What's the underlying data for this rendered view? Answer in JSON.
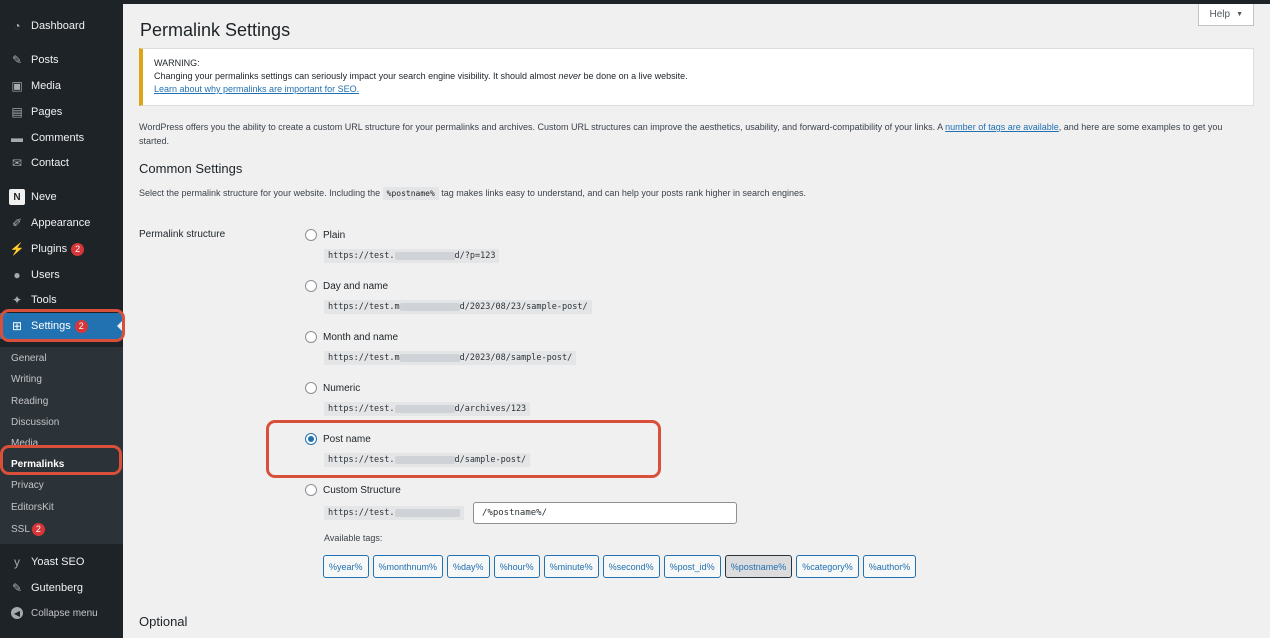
{
  "sidebar": {
    "menu": [
      {
        "id": "dashboard",
        "label": "Dashboard",
        "icon": "dashboard-icon",
        "glyph": "◔"
      },
      {
        "id": "posts",
        "label": "Posts",
        "icon": "pin-icon",
        "glyph": "✎"
      },
      {
        "id": "media",
        "label": "Media",
        "icon": "media-icon",
        "glyph": "▣"
      },
      {
        "id": "pages",
        "label": "Pages",
        "icon": "pages-icon",
        "glyph": "▤"
      },
      {
        "id": "comments",
        "label": "Comments",
        "icon": "comment-icon",
        "glyph": "▬"
      },
      {
        "id": "contact",
        "label": "Contact",
        "icon": "envelope-icon",
        "glyph": "✉"
      },
      {
        "id": "neve",
        "label": "Neve",
        "icon": "neve-logo-icon",
        "glyph": "N"
      },
      {
        "id": "appearance",
        "label": "Appearance",
        "icon": "brush-icon",
        "glyph": "✐"
      },
      {
        "id": "plugins",
        "label": "Plugins",
        "icon": "plug-icon",
        "glyph": "⚡",
        "badge": "2"
      },
      {
        "id": "users",
        "label": "Users",
        "icon": "user-icon",
        "glyph": "●"
      },
      {
        "id": "tools",
        "label": "Tools",
        "icon": "wrench-icon",
        "glyph": "✦"
      },
      {
        "id": "settings",
        "label": "Settings",
        "icon": "settings-icon",
        "glyph": "⊞",
        "badge": "2"
      }
    ],
    "submenu": [
      "General",
      "Writing",
      "Reading",
      "Discussion",
      "Media",
      "Permalinks",
      "Privacy",
      "EditorsKit",
      "SSL"
    ],
    "ssl_badge": "2",
    "bottom": [
      {
        "id": "yoast",
        "label": "Yoast SEO",
        "icon": "yoast-icon",
        "glyph": "y"
      },
      {
        "id": "gutenberg",
        "label": "Gutenberg",
        "icon": "pencil-icon",
        "glyph": "✎"
      },
      {
        "id": "collapse",
        "label": "Collapse menu",
        "icon": "collapse-icon",
        "glyph": "◀"
      }
    ]
  },
  "header": {
    "help_label": "Help",
    "help_arrow": "▼"
  },
  "page_title": "Permalink Settings",
  "warning": {
    "title": "WARNING:",
    "text_before": "Changing your permalinks settings can seriously impact your search engine visibility. It should almost ",
    "text_em": "never",
    "text_after": " be done on a live website.",
    "link": "Learn about why permalinks are important for SEO."
  },
  "intro": {
    "before": "WordPress offers you the ability to create a custom URL structure for your permalinks and archives. Custom URL structures can improve the aesthetics, usability, and forward-compatibility of your links. A ",
    "link": "number of tags are available",
    "after": ", and here are some examples to get you started."
  },
  "common_heading": "Common Settings",
  "desc": {
    "before": "Select the permalink structure for your website. Including the ",
    "tag": "%postname%",
    "after": " tag makes links easy to understand, and can help your posts rank higher in search engines."
  },
  "structure_label": "Permalink structure",
  "options": [
    {
      "label": "Plain",
      "url_prefix": "https://test.",
      "url_suffix": "d/?p=123",
      "checked": false
    },
    {
      "label": "Day and name",
      "url_prefix": "https://test.m",
      "url_suffix": "d/2023/08/23/sample-post/",
      "checked": false
    },
    {
      "label": "Month and name",
      "url_prefix": "https://test.m",
      "url_suffix": "d/2023/08/sample-post/",
      "checked": false
    },
    {
      "label": "Numeric",
      "url_prefix": "https://test.",
      "url_suffix": "d/archives/123",
      "checked": false
    },
    {
      "label": "Post name",
      "url_prefix": "https://test.",
      "url_suffix": "d/sample-post/",
      "checked": true
    },
    {
      "label": "Custom Structure",
      "url_prefix": "https://test.",
      "url_suffix": "",
      "checked": false
    }
  ],
  "custom_value": "/%postname%/",
  "available_tags_label": "Available tags:",
  "tags": [
    "%year%",
    "%monthnum%",
    "%day%",
    "%hour%",
    "%minute%",
    "%second%",
    "%post_id%",
    "%postname%",
    "%category%",
    "%author%"
  ],
  "selected_tag": "%postname%",
  "optional_heading": "Optional"
}
